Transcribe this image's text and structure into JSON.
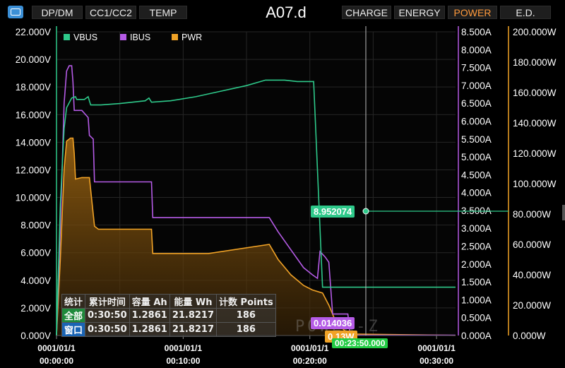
{
  "header": {
    "tabs_left": [
      "DP/DM",
      "CC1/CC2",
      "TEMP"
    ],
    "title": "A07.d",
    "tabs_right": [
      "CHARGE",
      "ENERGY",
      "POWER",
      "E.D."
    ],
    "active_tab": "POWER",
    "app_icon": "chart-window-icon"
  },
  "chart_data": {
    "type": "line",
    "title": "",
    "legend": [
      "VBUS",
      "IBUS",
      "PWR"
    ],
    "legend_position": "top-left",
    "grid": true,
    "x_ticks": [
      {
        "date": "0001/01/1",
        "time": "00:00:00",
        "minutes": 0
      },
      {
        "date": "0001/01/1",
        "time": "00:10:00",
        "minutes": 10
      },
      {
        "date": "0001/01/1",
        "time": "00:20:00",
        "minutes": 20
      },
      {
        "date": "0001/01/1",
        "time": "00:30:00",
        "minutes": 30
      }
    ],
    "xlim_minutes": [
      0,
      31.5
    ],
    "y_left": {
      "unit": "V",
      "lim": [
        0,
        22
      ],
      "ticks": [
        "0.000V",
        "2.000V",
        "4.000V",
        "6.000V",
        "8.000V",
        "10.000V",
        "12.000V",
        "14.000V",
        "16.000V",
        "18.000V",
        "20.000V",
        "22.000V"
      ]
    },
    "y_mid": {
      "unit": "A",
      "lim": [
        0,
        8.5
      ],
      "ticks": [
        "0.000A",
        "0.500A",
        "1.000A",
        "1.500A",
        "2.000A",
        "2.500A",
        "3.000A",
        "3.500A",
        "4.000A",
        "4.500A",
        "5.000A",
        "5.500A",
        "6.000A",
        "6.500A",
        "7.000A",
        "7.500A",
        "8.000A",
        "8.500A"
      ]
    },
    "y_right": {
      "unit": "W",
      "lim": [
        0,
        200
      ],
      "ticks": [
        "0.000W",
        "20.000W",
        "40.000W",
        "60.000W",
        "80.000W",
        "100.000W",
        "120.000W",
        "140.000W",
        "160.000W",
        "180.000W",
        "200.000W"
      ]
    },
    "series": [
      {
        "name": "VBUS",
        "color": "#2ec98a",
        "axis": "left",
        "points": [
          [
            0,
            0
          ],
          [
            0.3,
            9.5
          ],
          [
            0.6,
            15
          ],
          [
            0.8,
            16.5
          ],
          [
            1.2,
            17.2
          ],
          [
            1.5,
            17.3
          ],
          [
            1.6,
            17.1
          ],
          [
            2.2,
            17.1
          ],
          [
            2.5,
            17.3
          ],
          [
            2.7,
            16.7
          ],
          [
            3.5,
            16.7
          ],
          [
            5,
            16.8
          ],
          [
            7,
            17
          ],
          [
            7.3,
            17.2
          ],
          [
            7.5,
            16.9
          ],
          [
            9,
            17
          ],
          [
            11,
            17.3
          ],
          [
            13,
            17.7
          ],
          [
            15,
            18.1
          ],
          [
            16.5,
            18.5
          ],
          [
            17,
            18.5
          ],
          [
            18,
            18.5
          ],
          [
            19,
            18.4
          ],
          [
            20.3,
            18.4
          ],
          [
            21,
            3.5
          ],
          [
            23,
            3.5
          ],
          [
            31.5,
            3.5
          ]
        ]
      },
      {
        "name": "IBUS",
        "color": "#b55be6",
        "axis": "mid",
        "points": [
          [
            0,
            0
          ],
          [
            0.3,
            3
          ],
          [
            0.6,
            6.5
          ],
          [
            0.8,
            7.4
          ],
          [
            1,
            7.55
          ],
          [
            1.2,
            7.55
          ],
          [
            1.3,
            7.1
          ],
          [
            1.4,
            6.3
          ],
          [
            2,
            6.3
          ],
          [
            2.5,
            6.1
          ],
          [
            2.6,
            5.6
          ],
          [
            2.9,
            5.5
          ],
          [
            3.0,
            4.3
          ],
          [
            7.5,
            4.3
          ],
          [
            7.6,
            3.3
          ],
          [
            12,
            3.3
          ],
          [
            16.8,
            3.3
          ],
          [
            17.5,
            2.9
          ],
          [
            18.5,
            2.4
          ],
          [
            19.5,
            1.9
          ],
          [
            20.2,
            1.7
          ],
          [
            20.6,
            1.6
          ],
          [
            20.8,
            2.35
          ],
          [
            21.2,
            2.2
          ],
          [
            21.5,
            2.05
          ],
          [
            21.8,
            0.6
          ],
          [
            23,
            0.6
          ],
          [
            23.2,
            0.01
          ],
          [
            31.5,
            0.01
          ]
        ]
      },
      {
        "name": "PWR",
        "color": "#f0a226",
        "axis": "right",
        "points": [
          [
            0,
            0
          ],
          [
            0.3,
            50
          ],
          [
            0.6,
            110
          ],
          [
            0.8,
            128
          ],
          [
            1.1,
            130
          ],
          [
            1.3,
            130
          ],
          [
            1.4,
            120
          ],
          [
            1.5,
            103
          ],
          [
            2,
            104
          ],
          [
            2.6,
            104
          ],
          [
            2.7,
            96
          ],
          [
            3,
            72
          ],
          [
            3.3,
            70
          ],
          [
            7.5,
            70
          ],
          [
            7.6,
            54
          ],
          [
            12,
            54
          ],
          [
            16.8,
            60
          ],
          [
            17.5,
            50
          ],
          [
            18.5,
            40
          ],
          [
            19.5,
            33
          ],
          [
            20.2,
            30
          ],
          [
            21,
            28
          ],
          [
            21.5,
            20
          ],
          [
            22,
            10
          ],
          [
            23,
            1
          ],
          [
            31.5,
            0.1
          ]
        ]
      }
    ],
    "cursor": {
      "time": "00:23:50.000",
      "VBUS": "8.952074",
      "IBUS": "0.014036",
      "PWR": "0.13W"
    }
  },
  "stats": {
    "headers": [
      "统计",
      "累计时间",
      "容量 Ah",
      "能量 Wh",
      "计数 Points"
    ],
    "rows": [
      {
        "label": "全部",
        "time": "0:30:50",
        "ah": "1.2861",
        "wh": "21.8217",
        "points": "186"
      },
      {
        "label": "窗口",
        "time": "0:30:50",
        "ah": "1.2861",
        "wh": "21.8217",
        "points": "186"
      }
    ]
  },
  "watermark": "POWER-Z",
  "colors": {
    "vbus": "#2ec98a",
    "ibus": "#b55be6",
    "pwr": "#f0a226",
    "background": "#000000",
    "grid": "#2a2a2a",
    "active_tab": "#ff9a3c"
  }
}
